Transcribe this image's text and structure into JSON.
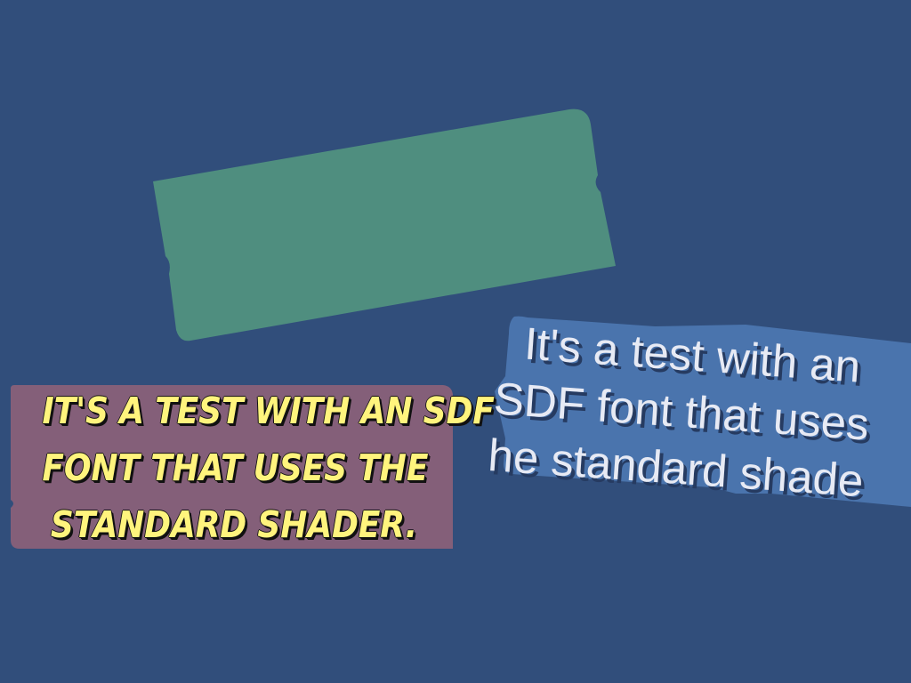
{
  "scene": {
    "background_color": "#314e7b",
    "shapes": {
      "green_panel_color": "#4f8e7f",
      "purple_panel_color": "#845f79",
      "blue_panel_color": "#4a74ad"
    },
    "comic_text": {
      "line_1": "IT'S A TEST WITH AN SDF",
      "line_2": "FONT THAT USES THE",
      "line_3": "STANDARD SHADER.",
      "color": "#fff47d"
    },
    "rotated_text": {
      "line_1": "It's a test with an",
      "line_2": "SDF font that uses",
      "line_3": "he standard shade",
      "color": "#e7eaf4"
    }
  }
}
